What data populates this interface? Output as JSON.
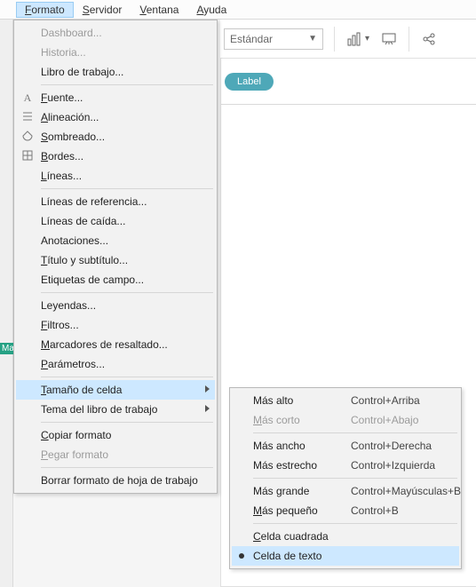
{
  "menubar": {
    "items": [
      "Formato",
      "Servidor",
      "Ventana",
      "Ayuda"
    ],
    "openIndex": 0
  },
  "toolbar": {
    "fit_label": "Estándar"
  },
  "canvas": {
    "pill_label": "Label"
  },
  "leftRail": {
    "tag": "Ma"
  },
  "formatMenu": {
    "items": [
      {
        "type": "item",
        "label": "Dashboard...",
        "disabled": true
      },
      {
        "type": "item",
        "label": "Historia...",
        "disabled": true
      },
      {
        "type": "item",
        "label": "Libro de trabajo..."
      },
      {
        "type": "sep"
      },
      {
        "type": "item",
        "label": "Fuente...",
        "mn": "F",
        "icon": "A"
      },
      {
        "type": "item",
        "label": "Alineación...",
        "mn": "A",
        "icon": "align"
      },
      {
        "type": "item",
        "label": "Sombreado...",
        "mn": "S",
        "icon": "shade"
      },
      {
        "type": "item",
        "label": "Bordes...",
        "mn": "B",
        "icon": "grid"
      },
      {
        "type": "item",
        "label": "Líneas...",
        "mn": "L"
      },
      {
        "type": "sep"
      },
      {
        "type": "item",
        "label": "Líneas de referencia..."
      },
      {
        "type": "item",
        "label": "Líneas de caída..."
      },
      {
        "type": "item",
        "label": "Anotaciones..."
      },
      {
        "type": "item",
        "label": "Título y subtítulo...",
        "mn": "T"
      },
      {
        "type": "item",
        "label": "Etiquetas de campo..."
      },
      {
        "type": "sep"
      },
      {
        "type": "item",
        "label": "Leyendas..."
      },
      {
        "type": "item",
        "label": "Filtros...",
        "mn": "F"
      },
      {
        "type": "item",
        "label": "Marcadores de resaltado...",
        "mn": "M"
      },
      {
        "type": "item",
        "label": "Parámetros...",
        "mn": "P"
      },
      {
        "type": "sep"
      },
      {
        "type": "item",
        "label": "Tamaño de celda",
        "mn": "T",
        "submenu": true,
        "highlight": true
      },
      {
        "type": "item",
        "label": "Tema del libro de trabajo",
        "submenu": true
      },
      {
        "type": "sep"
      },
      {
        "type": "item",
        "label": "Copiar formato",
        "mn": "C"
      },
      {
        "type": "item",
        "label": "Pegar formato",
        "mn": "P",
        "disabled": true
      },
      {
        "type": "sep"
      },
      {
        "type": "item",
        "label": "Borrar formato de hoja de trabajo"
      }
    ]
  },
  "cellSizeSubmenu": {
    "items": [
      {
        "type": "item",
        "label": "Más alto",
        "accel": "Control+Arriba"
      },
      {
        "type": "item",
        "label": "Más corto",
        "mn": "M",
        "accel": "Control+Abajo",
        "disabled": true
      },
      {
        "type": "sep"
      },
      {
        "type": "item",
        "label": "Más ancho",
        "accel": "Control+Derecha"
      },
      {
        "type": "item",
        "label": "Más estrecho",
        "accel": "Control+Izquierda"
      },
      {
        "type": "sep"
      },
      {
        "type": "item",
        "label": "Más grande",
        "accel": "Control+Mayúsculas+B"
      },
      {
        "type": "item",
        "label": "Más pequeño",
        "mn": "M",
        "accel": "Control+B"
      },
      {
        "type": "sep"
      },
      {
        "type": "item",
        "label": "Celda cuadrada",
        "mn": "C"
      },
      {
        "type": "item",
        "label": "Celda de texto",
        "radio": true,
        "highlight": true
      }
    ]
  }
}
